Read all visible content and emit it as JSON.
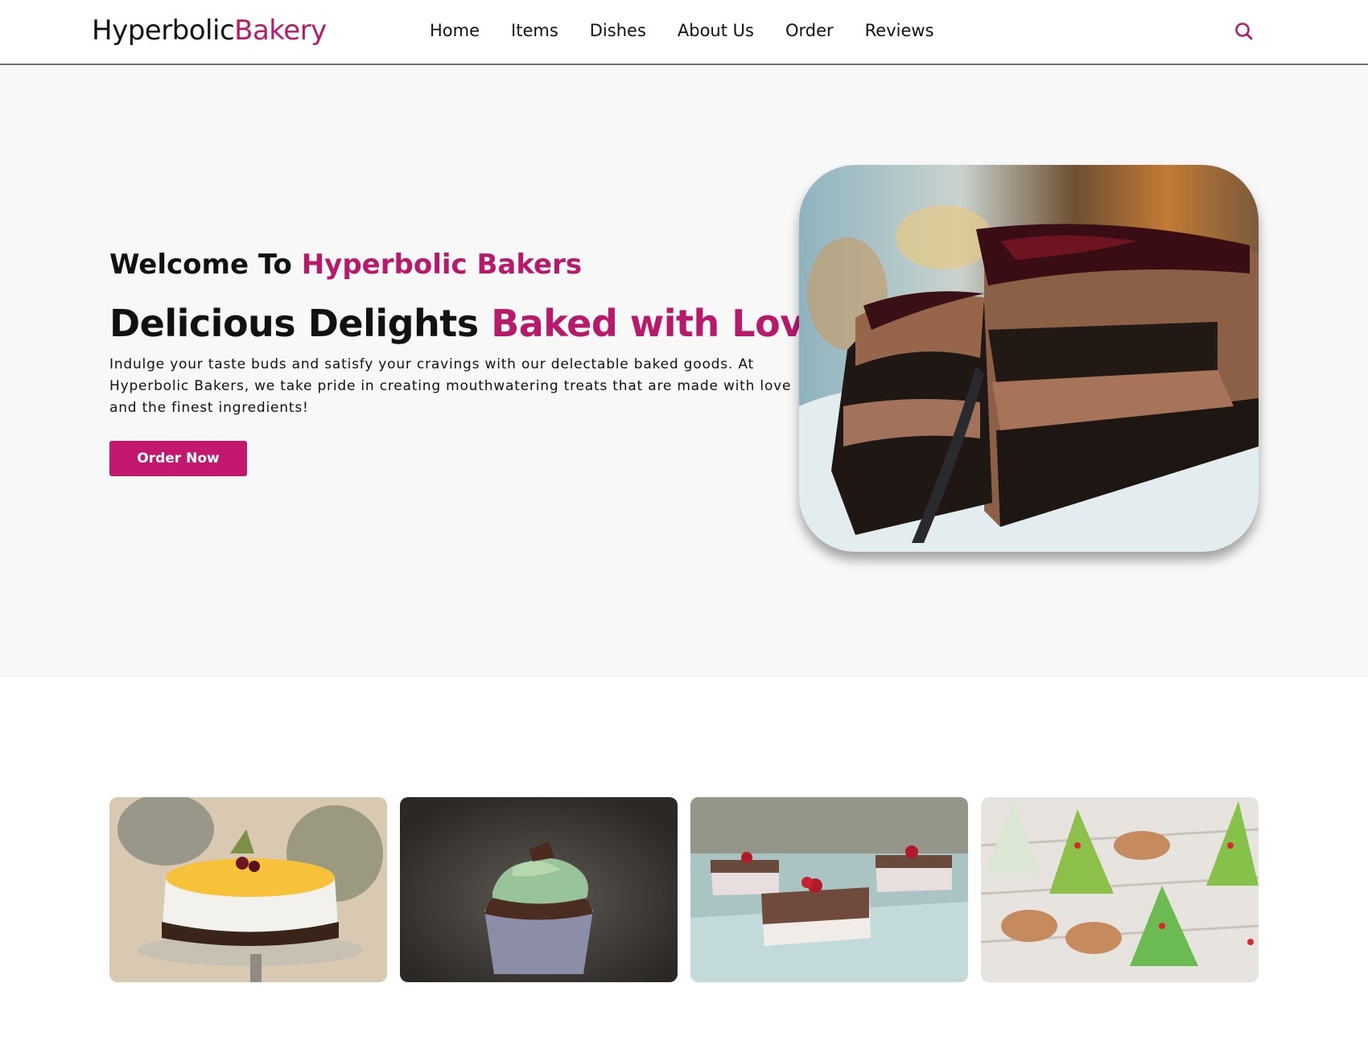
{
  "navbar": {
    "logo_main": "Hyperbolic",
    "logo_accent": "Bakery",
    "links": [
      "Home",
      "Items",
      "Dishes",
      "About Us",
      "Order",
      "Reviews"
    ],
    "search_icon": "search-icon"
  },
  "hero": {
    "welcome_prefix": "Welcome To ",
    "welcome_accent": "Hyperbolic Bakers",
    "headline_prefix": "Delicious Delights ",
    "headline_accent": "Baked with Love",
    "description": "Indulge your taste buds and satisfy your cravings with our delectable baked goods. At Hyperbolic Bakers, we take pride in creating mouthwatering treats that are made with love and the finest ingredients!",
    "order_button": "Order Now",
    "image": "chocolate-cake-slice-image"
  },
  "gallery": {
    "items": [
      {
        "image": "fruit-cake-image"
      },
      {
        "image": "cupcake-image"
      },
      {
        "image": "pastries-image"
      },
      {
        "image": "christmas-cookies-image"
      }
    ]
  },
  "colors": {
    "accent": "#b81a6b",
    "button": "#c2186d",
    "hero_bg": "#f8f8f8"
  }
}
